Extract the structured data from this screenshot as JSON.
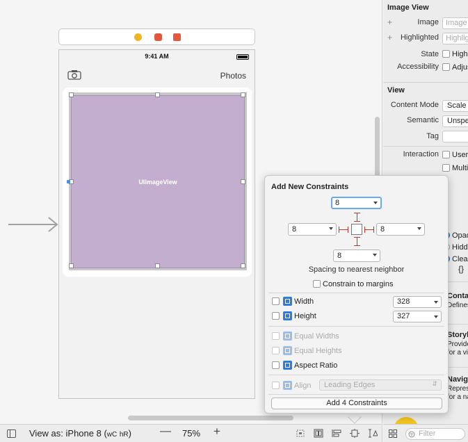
{
  "scene": {
    "status_time": "9:41 AM",
    "nav_title": "Photos",
    "image_view_label": "UIImageView"
  },
  "bottom_bar": {
    "view_as_prefix": "View as: iPhone 8 (",
    "size_class_w": "wC",
    "size_class_h": "hR",
    "view_as_suffix": ")",
    "zoom_out": "—",
    "zoom_level": "75%",
    "zoom_in": "+"
  },
  "inspector": {
    "image_view_header": "Image View",
    "image_label": "Image",
    "image_placeholder": "Image",
    "highlighted_label": "Highlighted",
    "highlighted_placeholder": "Highlighted",
    "state_label": "State",
    "state_option": "Highlighted",
    "accessibility_label": "Accessibility",
    "accessibility_option": "Adjusts Image Size",
    "view_header": "View",
    "content_mode_label": "Content Mode",
    "content_mode_value": "Scale To Fill",
    "semantic_label": "Semantic",
    "semantic_value": "Unspecified",
    "tag_label": "Tag",
    "interaction_label": "Interaction",
    "interaction_user": "User Interaction Enabled",
    "interaction_multi": "Multiple Touch",
    "opaque": "Opaque",
    "hidden": "Hidden",
    "clears": "Clears Graphics Context",
    "braces": "{}",
    "lib_item_1_title": "Container View Controller",
    "lib_item_1_sub": "Defines a view controller",
    "lib_item_2_title": "Storyboard Reference",
    "lib_item_2_sub1": "Provides a placeholder",
    "lib_item_2_sub2": "for a view controller in an external storyboard",
    "lib_item_3_title": "Navigation Item",
    "lib_item_3_sub1": "Represents a placeholder that",
    "lib_item_3_sub2": "for a navigation bar...",
    "filter_placeholder": "Filter"
  },
  "popover": {
    "title": "Add New Constraints",
    "top_value": "8",
    "left_value": "8",
    "right_value": "8",
    "bottom_value": "8",
    "spacing_caption": "Spacing to nearest neighbor",
    "constrain_margins": "Constrain to margins",
    "width_label": "Width",
    "width_value": "328",
    "height_label": "Height",
    "height_value": "327",
    "equal_widths": "Equal Widths",
    "equal_heights": "Equal Heights",
    "aspect_ratio": "Aspect Ratio",
    "align_label": "Align",
    "align_value": "Leading Edges",
    "add_button": "Add 4 Constraints"
  }
}
